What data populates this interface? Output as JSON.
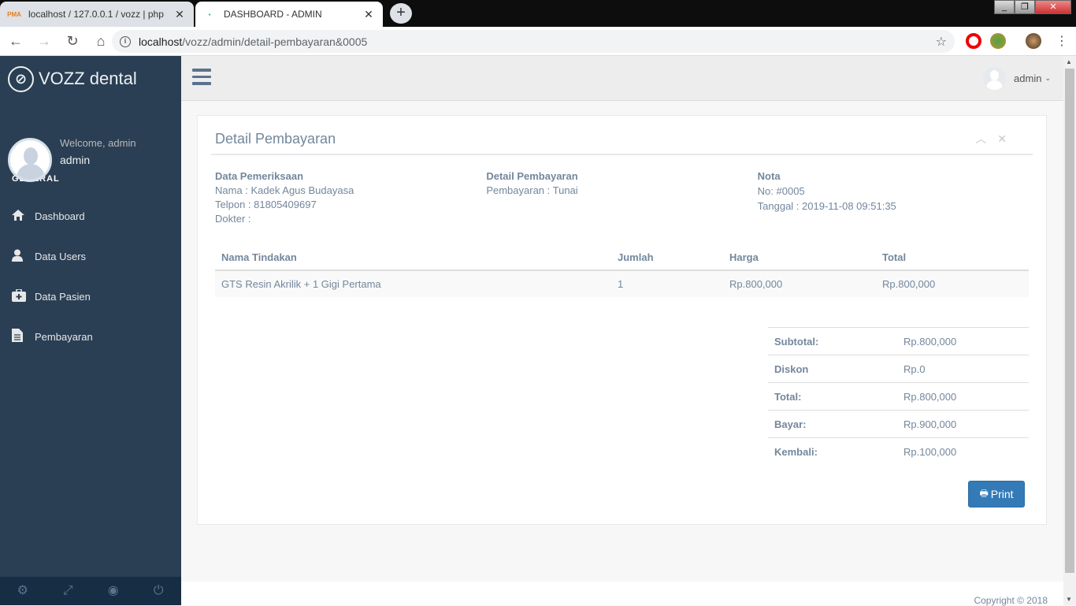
{
  "browser": {
    "tabs": [
      {
        "title": "localhost / 127.0.0.1 / vozz | php",
        "favicon": "phpmyadmin-icon"
      },
      {
        "title": "DASHBOARD - ADMIN",
        "favicon": "vozz-favicon"
      }
    ],
    "url_host": "localhost",
    "url_path": "/vozz/admin/detail-pembayaran&0005"
  },
  "sidebar": {
    "brand": "VOZZ dental",
    "welcome": "Welcome, admin",
    "username": "admin",
    "section": "GENERAL",
    "items": [
      {
        "label": "Dashboard",
        "icon": "home-icon"
      },
      {
        "label": "Data Users",
        "icon": "user-icon"
      },
      {
        "label": "Data Pasien",
        "icon": "medkit-icon"
      },
      {
        "label": "Pembayaran",
        "icon": "file-icon"
      }
    ],
    "footer_icons": [
      "gear-icon",
      "fullscreen-icon",
      "eye-slash-icon",
      "power-icon"
    ]
  },
  "topnav": {
    "user": "admin"
  },
  "panel": {
    "title": "Detail Pembayaran",
    "pemeriksaan": {
      "heading": "Data Pemeriksaan",
      "nama": "Nama : Kadek Agus Budayasa",
      "telpon": "Telpon : 81805409697",
      "dokter": "Dokter :"
    },
    "pembayaran": {
      "heading": "Detail Pembayaran",
      "metode": "Pembayaran : Tunai"
    },
    "nota": {
      "heading": "Nota",
      "no": "No: #0005",
      "tanggal": "Tanggal : 2019-11-08 09:51:35"
    },
    "table": {
      "headers": [
        "Nama Tindakan",
        "Jumlah",
        "Harga",
        "Total"
      ],
      "rows": [
        [
          "GTS Resin Akrilik + 1 Gigi Pertama",
          "1",
          "Rp.800,000",
          "Rp.800,000"
        ]
      ]
    },
    "summary": [
      {
        "label": "Subtotal:",
        "value": "Rp.800,000"
      },
      {
        "label": "Diskon",
        "value": "Rp.0"
      },
      {
        "label": "Total:",
        "value": "Rp.800,000"
      },
      {
        "label": "Bayar:",
        "value": "Rp.900,000"
      },
      {
        "label": "Kembali:",
        "value": "Rp.100,000"
      }
    ],
    "print_label": "Print"
  },
  "footer": {
    "copyright": "Copyright © 2018"
  },
  "colors": {
    "sidebar": "#2a3f54",
    "sidebar_footer": "#172d44",
    "primary": "#337ab7",
    "text": "#73879c"
  }
}
